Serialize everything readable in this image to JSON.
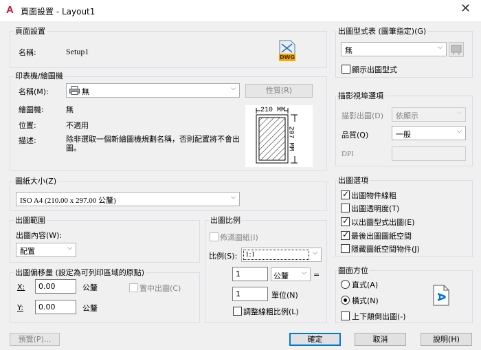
{
  "window": {
    "title": "頁面設置 - Layout1",
    "close_glyph": "✕"
  },
  "page_setup": {
    "group_label": "頁面設置",
    "name_label": "名稱:",
    "name_value": "Setup1",
    "dwg_badge": "DWG"
  },
  "printer": {
    "group_label": "印表機/繪圖機",
    "name_label": "名稱(M):",
    "name_value": "無",
    "properties_button": "性質(R)",
    "plotter_label": "繪圖機:",
    "plotter_value": "無",
    "location_label": "位置:",
    "location_value": "不適用",
    "description_label": "描述:",
    "description_value": "除非選取一個新繪圖機規劃名稱，否則配置將不會出圖。",
    "preview_width": "210 MM",
    "preview_height": "297 MM"
  },
  "paper_size": {
    "group_label": "圖紙大小(Z)",
    "value": "ISO A4 (210.00 x 297.00 公釐)"
  },
  "plot_area": {
    "group_label": "出圖範圍",
    "what_label": "出圖內容(W):",
    "what_value": "配置"
  },
  "plot_offset": {
    "group_label": "出圖偏移量 (設定為可列印區域的原點)",
    "x_label": "X:",
    "x_value": "0.00",
    "x_unit": "公釐",
    "y_label": "Y:",
    "y_value": "0.00",
    "y_unit": "公釐",
    "center_label": "置中出圖(C)"
  },
  "plot_scale": {
    "group_label": "出圖比例",
    "fit_label": "佈滿圖紙(I)",
    "scale_label": "比例(S):",
    "scale_value": "1:1",
    "value1": "1",
    "unit_value": "公釐",
    "equals": "=",
    "value2": "1",
    "unit2_label": "單位(N)",
    "lineweights_label": "調整線粗比例(L)"
  },
  "plot_style": {
    "group_label": "出圖型式表 (圖筆指定)(G)",
    "value": "無",
    "display_label": "顯示出圖型式"
  },
  "shaded": {
    "group_label": "描影視埠選項",
    "shade_label": "描影出圖(D)",
    "shade_value": "依顯示",
    "quality_label": "品質(Q)",
    "quality_value": "一般",
    "dpi_label": "DPI",
    "dpi_value": ""
  },
  "plot_options": {
    "group_label": "出圖選項",
    "items": [
      {
        "label": "出圖物件線粗",
        "checked": true
      },
      {
        "label": "出圖透明度(T)",
        "checked": false
      },
      {
        "label": "以出圖型式出圖(E)",
        "checked": true
      },
      {
        "label": "最後出圖圖紙空間",
        "checked": true
      },
      {
        "label": "隱藏圖紙空間物件(J)",
        "checked": false
      }
    ]
  },
  "orientation": {
    "group_label": "圖面方位",
    "portrait_label": "直式(A)",
    "landscape_label": "橫式(N)",
    "upside_label": "上下顛倒出圖(-)",
    "icon_letter": "A"
  },
  "buttons": {
    "preview": "預覽(P)...",
    "ok": "確定",
    "cancel": "取消",
    "help": "說明(H)"
  },
  "colors": {
    "accent": "#0078d7",
    "autocad_red": "#c8102e"
  }
}
